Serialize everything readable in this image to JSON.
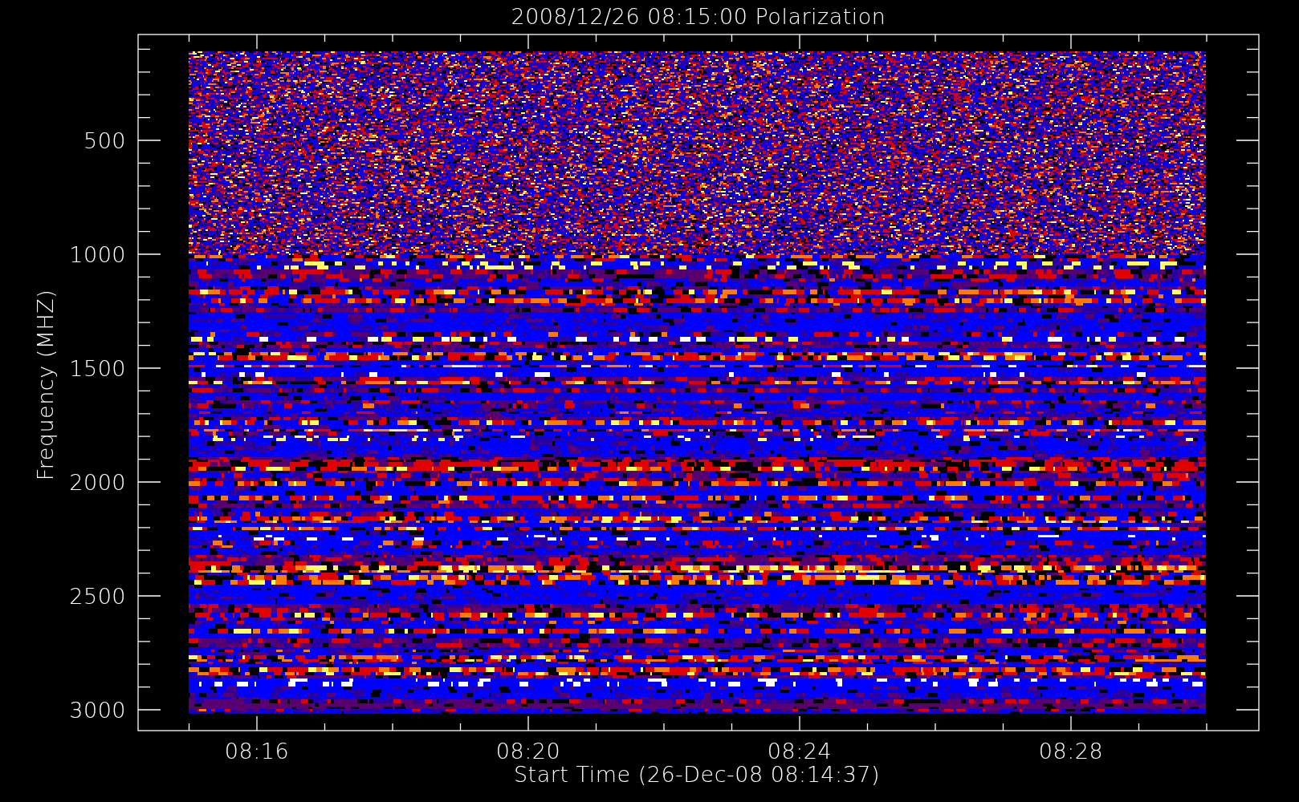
{
  "title": "2008/12/26 08:15:00 Polarization",
  "ylabel": "Frequency (MHZ)",
  "xlabel": "Start Time (26-Dec-08 08:14:37)",
  "yticks": [
    "500",
    "1000",
    "1500",
    "2000",
    "2500",
    "3000"
  ],
  "xticks": [
    "08:16",
    "08:20",
    "08:24",
    "08:28"
  ]
}
